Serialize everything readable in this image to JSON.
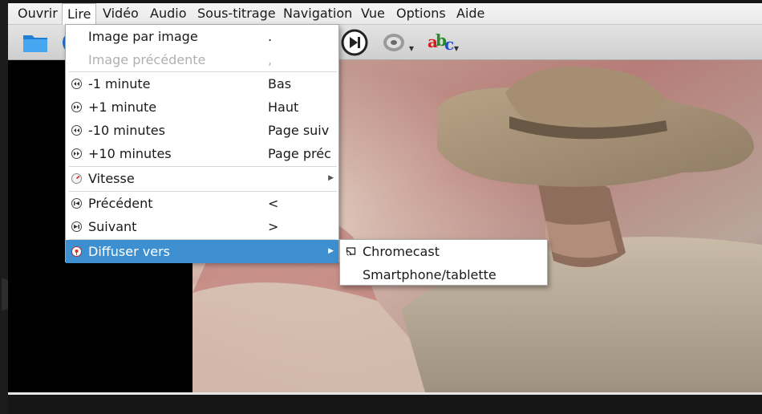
{
  "menubar": {
    "items": [
      {
        "label": "Ouvrir"
      },
      {
        "label": "Lire"
      },
      {
        "label": "Vidéo"
      },
      {
        "label": "Audio"
      },
      {
        "label": "Sous-titrage"
      },
      {
        "label": "Navigation"
      },
      {
        "label": "Vue"
      },
      {
        "label": "Options"
      },
      {
        "label": "Aide"
      }
    ],
    "open_item": "Lire"
  },
  "toolbar": {
    "icons": [
      "open-folder-icon",
      "play-icon",
      "next-frame-icon",
      "audio-speaker-icon",
      "subtitles-abc-icon"
    ]
  },
  "play_menu": {
    "items": [
      {
        "label": "Image par image",
        "shortcut": "."
      },
      {
        "label": "Image précédente",
        "shortcut": ",",
        "disabled": true
      },
      {
        "label": "-1 minute",
        "shortcut": "Bas"
      },
      {
        "label": "+1 minute",
        "shortcut": "Haut"
      },
      {
        "label": "-10 minutes",
        "shortcut": "Page suiv"
      },
      {
        "label": "+10 minutes",
        "shortcut": "Page préc"
      },
      {
        "label": "Vitesse",
        "shortcut": ""
      },
      {
        "label": "Précédent",
        "shortcut": "<"
      },
      {
        "label": "Suivant",
        "shortcut": ">"
      },
      {
        "label": "Diffuser vers",
        "shortcut": ""
      }
    ]
  },
  "cast_submenu": {
    "items": [
      {
        "label": "Chromecast"
      },
      {
        "label": "Smartphone/tablette"
      }
    ]
  },
  "colors": {
    "highlight": "#3d8fd0",
    "menubar_bg": "#efefef"
  }
}
